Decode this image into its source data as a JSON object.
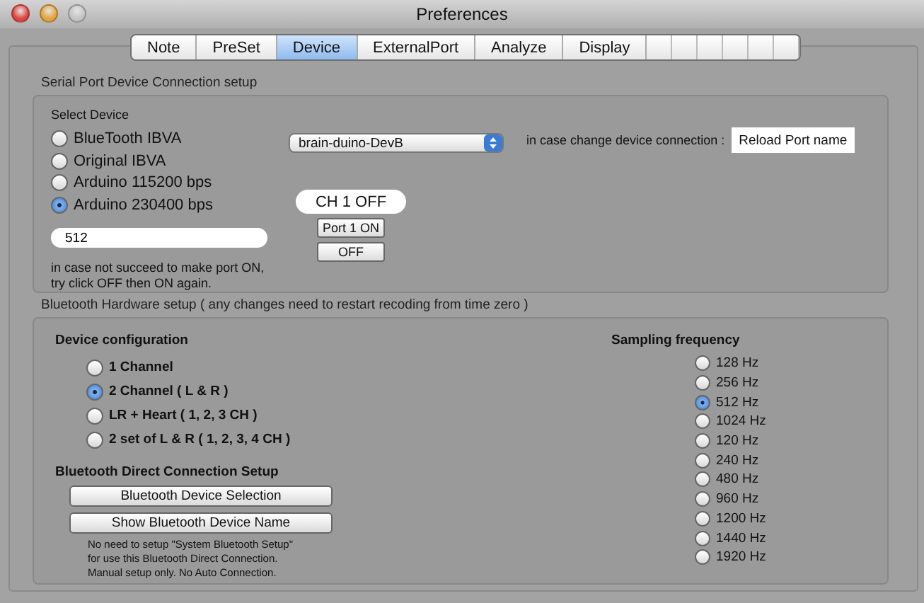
{
  "window": {
    "title": "Preferences"
  },
  "tabs": [
    {
      "label": "Note",
      "selected": false
    },
    {
      "label": "PreSet",
      "selected": false
    },
    {
      "label": "Device",
      "selected": true
    },
    {
      "label": "ExternalPort",
      "selected": false
    },
    {
      "label": "Analyze",
      "selected": false
    },
    {
      "label": "Display",
      "selected": false
    }
  ],
  "serial": {
    "title": "Serial Port Device Connection setup",
    "select_label": "Select Device",
    "devices": [
      {
        "label": "BlueTooth IBVA",
        "selected": false
      },
      {
        "label": "Original IBVA",
        "selected": false
      },
      {
        "label": "Arduino 115200 bps",
        "selected": false
      },
      {
        "label": "Arduino 230400 bps",
        "selected": true
      }
    ],
    "port_field": {
      "value": "512"
    },
    "hint": [
      "in case not succeed to make port ON,",
      "try click OFF then ON again."
    ],
    "port_dropdown": {
      "value": "brain-duino-DevB"
    },
    "channel_status": "CH 1 OFF",
    "port_on_button": "Port 1 ON",
    "off_button": "OFF",
    "reload_label": "in case change device connection :",
    "reload_button": "Reload Port name"
  },
  "bluetooth": {
    "title": "Bluetooth Hardware setup ( any changes need to restart recoding from time zero )",
    "config_label": "Device configuration",
    "configs": [
      {
        "label": "1 Channel",
        "selected": false
      },
      {
        "label": "2 Channel ( L & R )",
        "selected": true
      },
      {
        "label": "LR + Heart ( 1, 2, 3 CH )",
        "selected": false
      },
      {
        "label": "2 set of L & R ( 1, 2, 3, 4 CH )",
        "selected": false
      }
    ],
    "direct_label": "Bluetooth Direct Connection Setup",
    "buttons": [
      "Bluetooth Device Selection",
      "Show Bluetooth Device Name"
    ],
    "note": [
      "No need to setup \"System Bluetooth Setup\"",
      "for use this Bluetooth Direct Connection.",
      "Manual setup only. No Auto Connection."
    ],
    "sampling_label": "Sampling frequency",
    "frequencies": [
      {
        "label": "128 Hz",
        "selected": false
      },
      {
        "label": "256 Hz",
        "selected": false
      },
      {
        "label": "512 Hz",
        "selected": true
      },
      {
        "label": "1024 Hz",
        "selected": false
      },
      {
        "label": "120 Hz",
        "selected": false
      },
      {
        "label": "240 Hz",
        "selected": false
      },
      {
        "label": "480 Hz",
        "selected": false
      },
      {
        "label": "960 Hz",
        "selected": false
      },
      {
        "label": "1200 Hz",
        "selected": false
      },
      {
        "label": "1440 Hz",
        "selected": false
      },
      {
        "label": "1920 Hz",
        "selected": false
      }
    ]
  }
}
